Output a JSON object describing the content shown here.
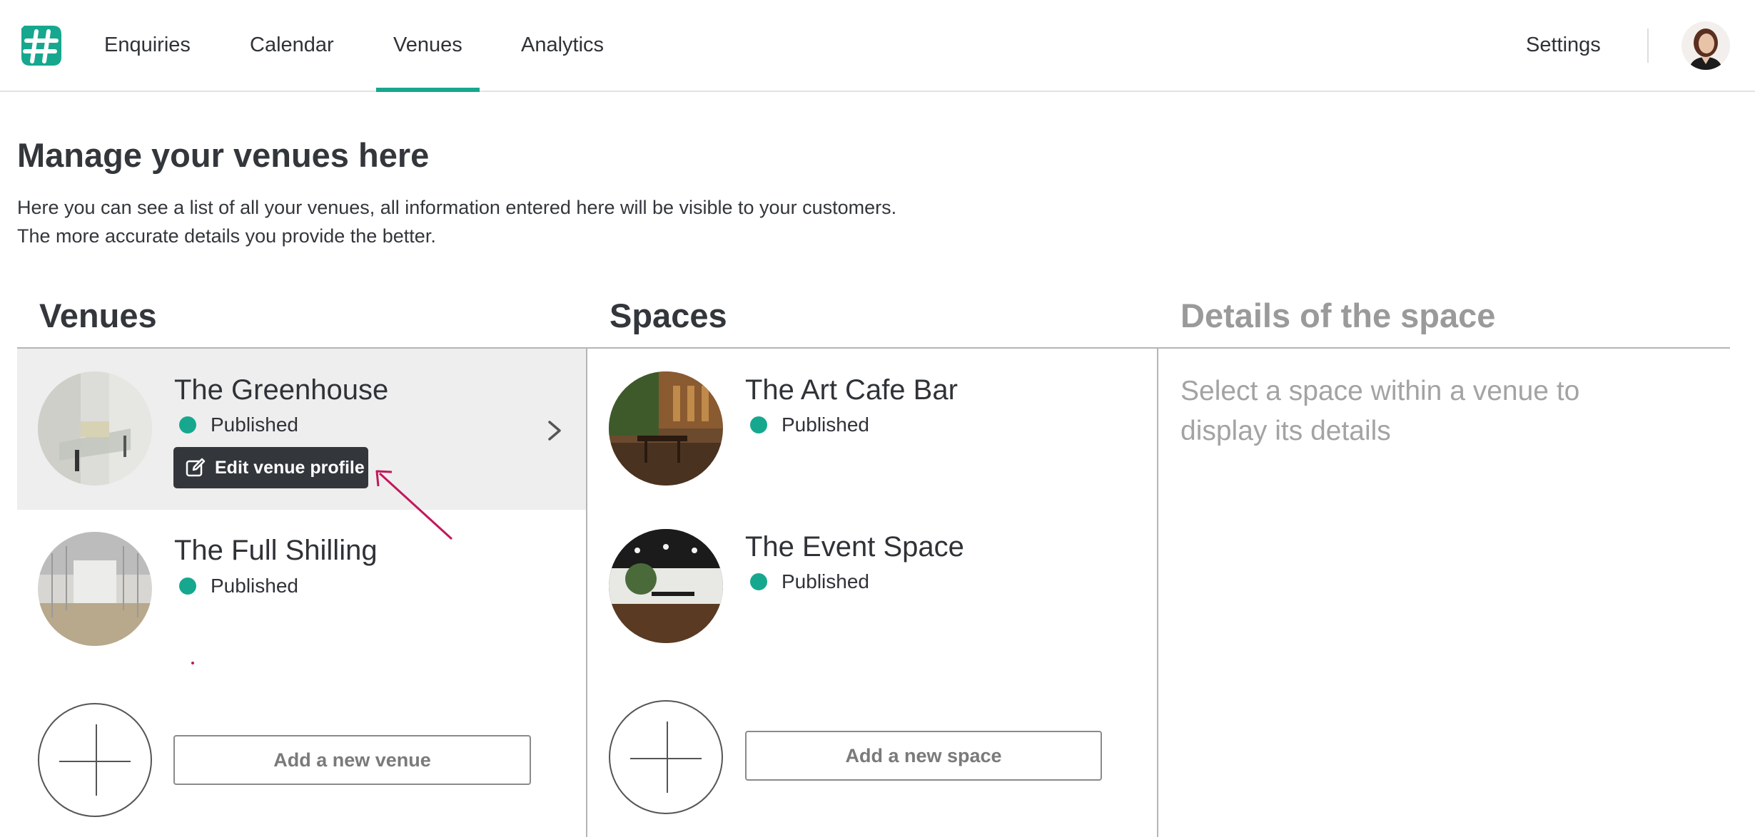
{
  "nav": {
    "items": [
      {
        "label": "Enquiries"
      },
      {
        "label": "Calendar"
      },
      {
        "label": "Venues",
        "active": true
      },
      {
        "label": "Analytics"
      }
    ],
    "settings_label": "Settings",
    "accent_color": "#16a88f"
  },
  "page": {
    "title": "Manage your venues here",
    "intro_line1": "Here you can see a list of all your venues, all information entered here will be visible to your customers.",
    "intro_line2": "The more accurate details you provide the better."
  },
  "columns": {
    "venues_heading": "Venues",
    "spaces_heading": "Spaces",
    "details_heading": "Details of the space"
  },
  "venues": [
    {
      "name": "The Greenhouse",
      "status": "Published",
      "selected": true
    },
    {
      "name": "The Full Shilling",
      "status": "Published",
      "selected": false
    }
  ],
  "edit_venue_label": "Edit venue profile",
  "add_venue_label": "Add a new venue",
  "spaces": [
    {
      "name": "The Art Cafe Bar",
      "status": "Published"
    },
    {
      "name": "The Event Space",
      "status": "Published"
    }
  ],
  "add_space_label": "Add a new space",
  "details": {
    "hint": "Select a space within a venue to display its details"
  },
  "icons": {
    "logo": "hash-logo-icon",
    "edit": "edit-pencil-icon",
    "chevron": "chevron-right-icon",
    "plus": "plus-icon"
  }
}
